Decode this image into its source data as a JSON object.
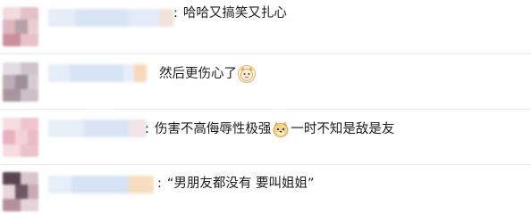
{
  "comments": [
    {
      "separator": ":",
      "text": "哈哈又搞笑又扎心",
      "emoji_after_text": "",
      "text_after_emoji": "",
      "colors": {
        "avatar_main": "#e9c9cf",
        "avatar_accent": "#b7a0a7",
        "name_bar": "#dfe9f6",
        "name_tail": "#f3e2d9"
      }
    },
    {
      "separator": "",
      "text": "然后更伤心了",
      "emoji_after_text": "cat-face",
      "text_after_emoji": "",
      "colors": {
        "avatar_main": "#d8d0d6",
        "avatar_accent": "#9f8e98",
        "name_bar": "#dce8f7",
        "name_tail": "#f7d8b9"
      }
    },
    {
      "separator": ":",
      "text": "伤害不高侮辱性极强",
      "emoji_after_text": "doge-face",
      "text_after_emoji": "一时不知是敌是友",
      "colors": {
        "avatar_main": "#f0c9d0",
        "avatar_accent": "#e7b1bf",
        "name_bar": "#e1ebf6",
        "name_tail": "#f2e4e7"
      }
    },
    {
      "separator": ":",
      "text": "“男朋友都没有 要叫姐姐”",
      "emoji_after_text": "",
      "text_after_emoji": "",
      "colors": {
        "avatar_main": "#cfb9c2",
        "avatar_accent": "#6e5662",
        "name_bar": "#dde8f5",
        "name_tail": "#f5ddbd"
      }
    }
  ]
}
